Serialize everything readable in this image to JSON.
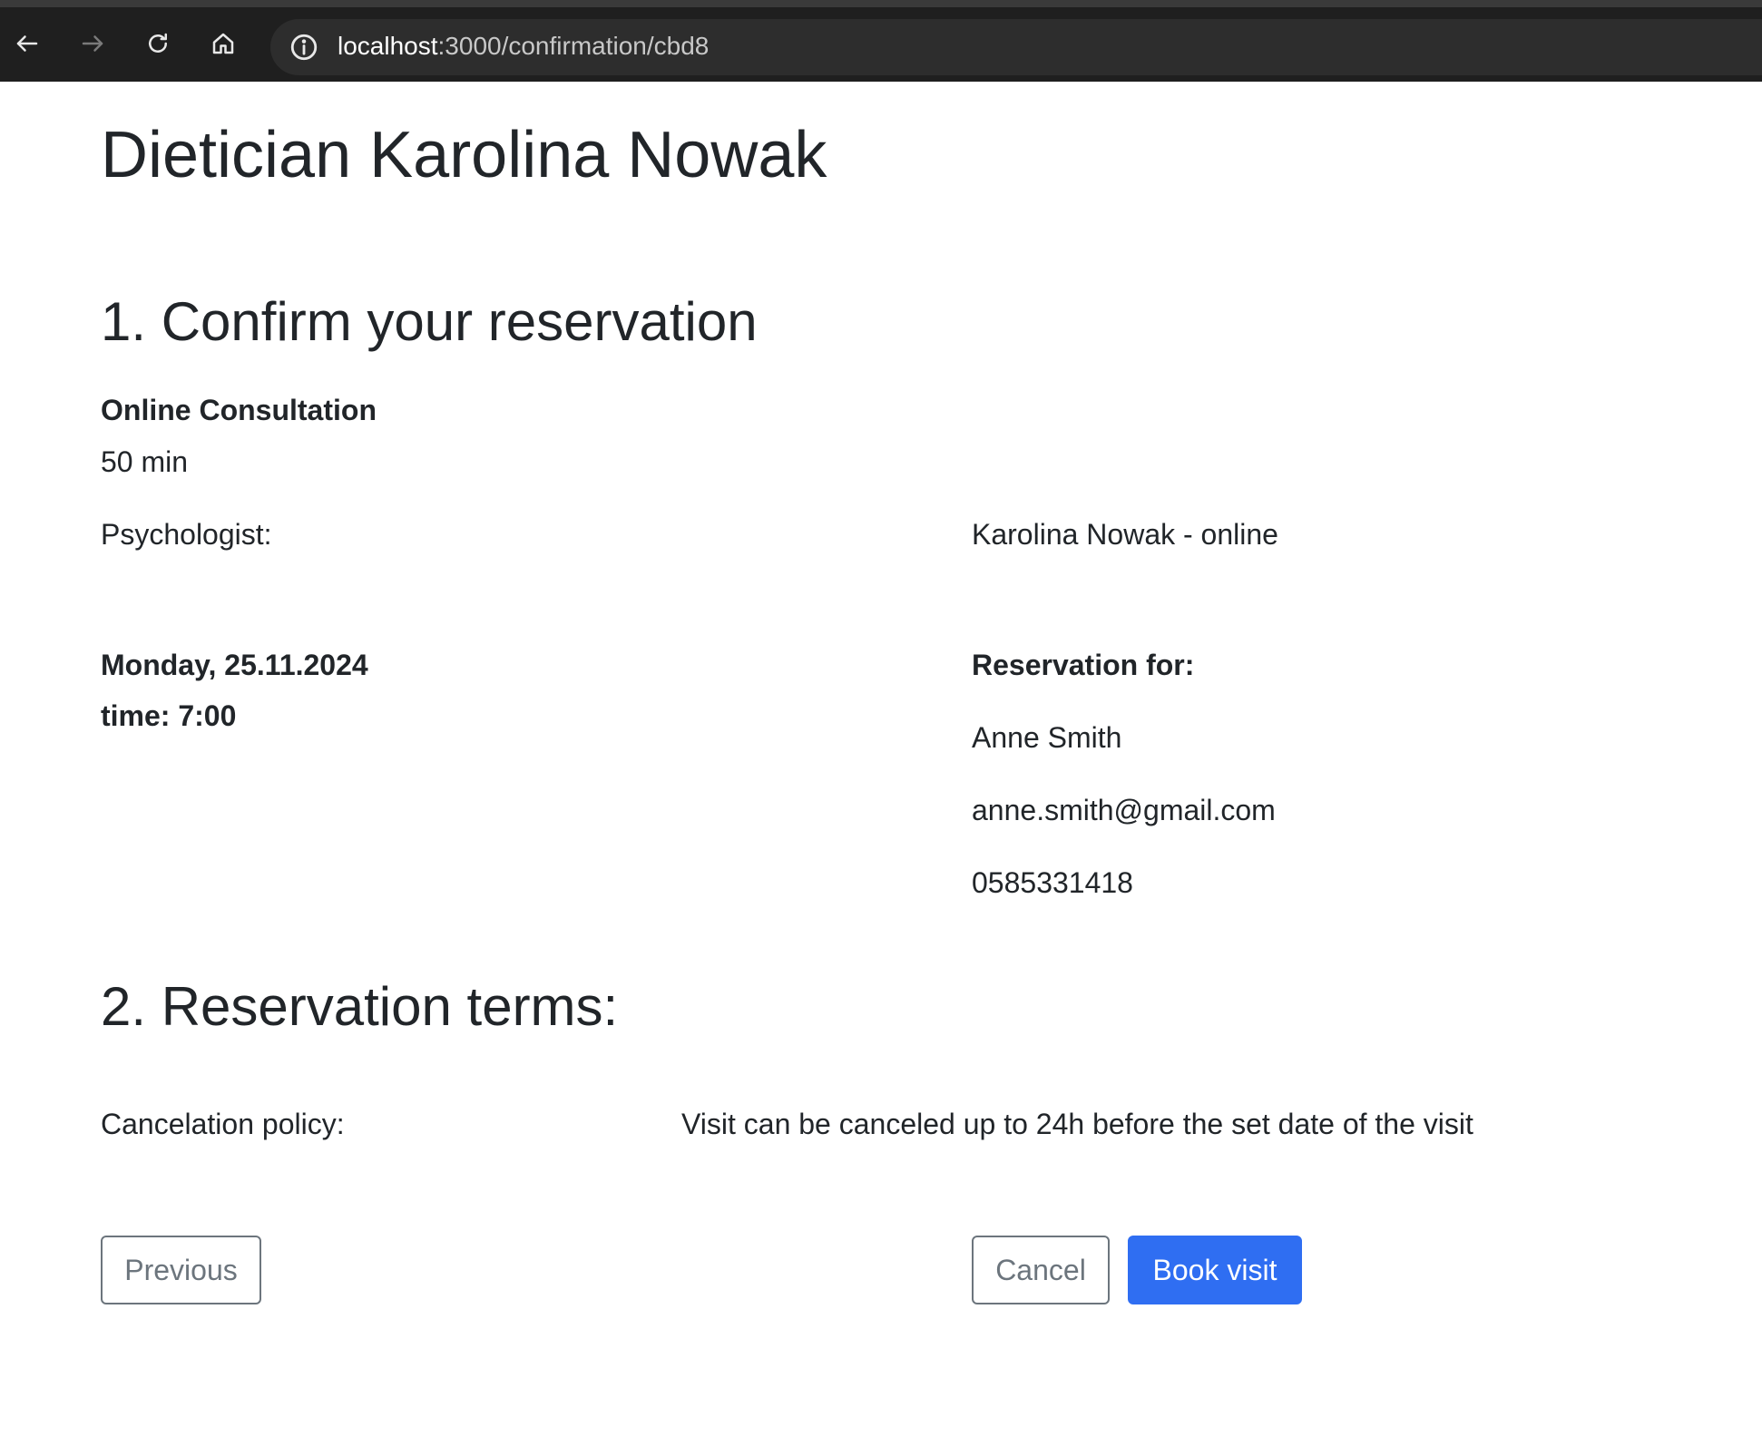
{
  "browser": {
    "url_host": "localhost",
    "url_path": ":3000/confirmation/cbd8",
    "icons": [
      "back-arrow-icon",
      "forward-arrow-icon",
      "reload-icon",
      "home-icon",
      "info-icon"
    ]
  },
  "page": {
    "title": "Dietician Karolina Nowak"
  },
  "section1": {
    "title": "1. Confirm your reservation",
    "service_name": "Online Consultation",
    "duration": "50 min",
    "specialist_label": "Psychologist:",
    "specialist_value": "Karolina Nowak - online",
    "date": "Monday, 25.11.2024",
    "time": "time: 7:00",
    "reservation_for_label": "Reservation for:",
    "client_name": "Anne Smith",
    "client_email": "anne.smith@gmail.com",
    "client_phone": "0585331418"
  },
  "section2": {
    "title": "2. Reservation terms:",
    "policy_label": "Cancelation policy:",
    "policy_value": "Visit can be canceled up to 24h before the set date of the visit"
  },
  "actions": {
    "previous_label": "Previous",
    "cancel_label": "Cancel",
    "book_label": "Book visit"
  },
  "colors": {
    "primary": "#2f6ef2",
    "outline": "#6c757d",
    "text": "#212529",
    "browser_bar": "#1f1f1f"
  }
}
